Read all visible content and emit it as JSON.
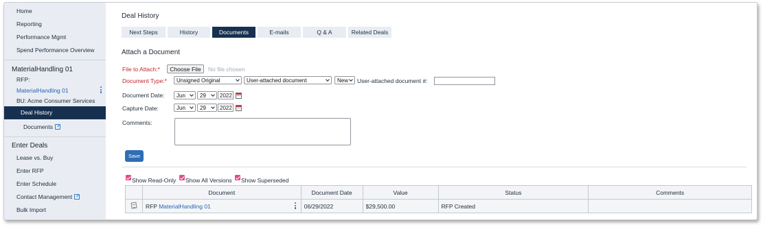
{
  "sidebar": {
    "top_items": [
      "Home",
      "Reporting",
      "Performance Mgmt",
      "Spend Performance Overview"
    ],
    "deal_heading": "MaterialHandling 01",
    "rfp_label": "RFP:",
    "rfp_link": "MaterialHandling 01",
    "bu_text": "BU: Acme Consumer Services",
    "active_item": "Deal History",
    "documents_item": "Documents",
    "enter_heading": "Enter Deals",
    "enter_items": [
      "Lease vs. Buy",
      "Enter RFP",
      "Enter Schedule",
      "Contact Management",
      "Bulk Import"
    ]
  },
  "main": {
    "title": "Deal History",
    "tabs": [
      "Next Steps",
      "History",
      "Documents",
      "E-mails",
      "Q & A",
      "Related Deals"
    ],
    "active_tab": "Documents",
    "section_title": "Attach a Document"
  },
  "form": {
    "file_label": "File to Attach:*",
    "choose_file": "Choose File",
    "no_file": "No file chosen",
    "doc_type_label": "Document Type:*",
    "doc_type_value": "Unsigned Original",
    "doc_source_value": "User-attached document",
    "doc_new_value": "New",
    "doc_number_label": "User-attached document #:",
    "doc_number_value": "",
    "doc_date_label": "Document Date:",
    "capture_date_label": "Capture Date:",
    "doc_date": {
      "month": "Jun",
      "day": "29",
      "year": "2022"
    },
    "capture_date": {
      "month": "Jun",
      "day": "29",
      "year": "2022"
    },
    "comments_label": "Comments:",
    "comments_value": "",
    "save": "Save"
  },
  "filters": {
    "read_only": "Show Read-Only",
    "all_versions": "Show All Versions",
    "superseded": "Show Superseded"
  },
  "table": {
    "headers": [
      "Document",
      "Document Date",
      "Value",
      "Status",
      "Comments"
    ],
    "rows": [
      {
        "prefix": "RFP",
        "link": "MaterialHandling 01",
        "date": "06/29/2022",
        "value": "$29,500.00",
        "status": "RFP Created",
        "comments": ""
      }
    ]
  },
  "colors": {
    "nav_active": "#17304f",
    "accent_blue": "#2f6db5",
    "required_red": "#c0282e",
    "checkbox_pink": "#e44b86"
  }
}
